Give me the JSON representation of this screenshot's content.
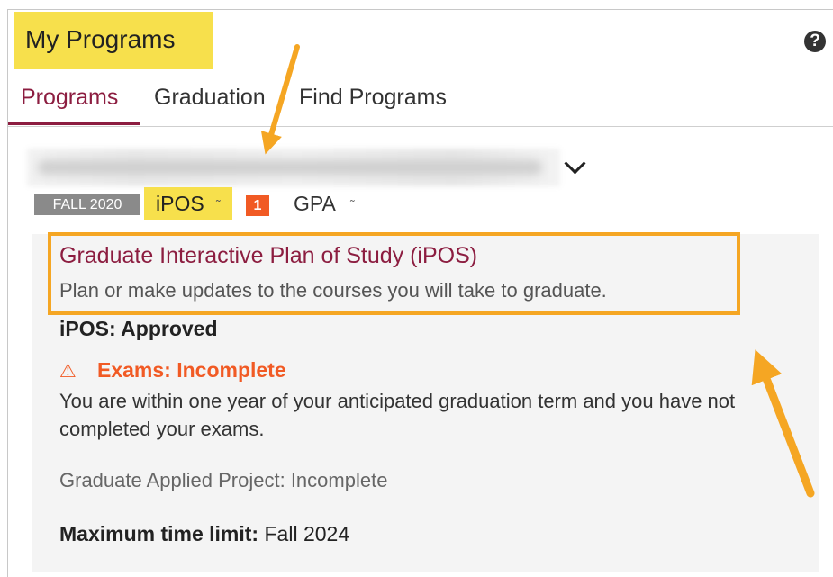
{
  "header": {
    "title": "My Programs",
    "help_icon": "?"
  },
  "tabs": [
    {
      "label": "Programs",
      "active": true
    },
    {
      "label": "Graduation",
      "active": false
    },
    {
      "label": "Find Programs",
      "active": false
    }
  ],
  "program": {
    "term_badge": "FALL 2020",
    "ipos_label": "iPOS",
    "ipos_caret": "˜",
    "notification_count": "1",
    "gpa_label": "GPA",
    "gpa_caret": "˜"
  },
  "card": {
    "title": "Graduate Interactive Plan of Study (iPOS)",
    "description": "Plan or make updates to the courses you will take to graduate.",
    "ipos_status": "iPOS: Approved",
    "warning_icon": "⚠",
    "exam_status": "Exams: Incomplete",
    "exam_description": "You are within one year of your anticipated graduation term and you have not completed your exams.",
    "project_status": "Graduate Applied Project: Incomplete",
    "time_limit_label": "Maximum time limit:",
    "time_limit_value": " Fall 2024"
  },
  "colors": {
    "highlight": "#f7e04c",
    "brand": "#8c1d40",
    "warning": "#f15a24",
    "annotation_arrow": "#f5a623"
  }
}
